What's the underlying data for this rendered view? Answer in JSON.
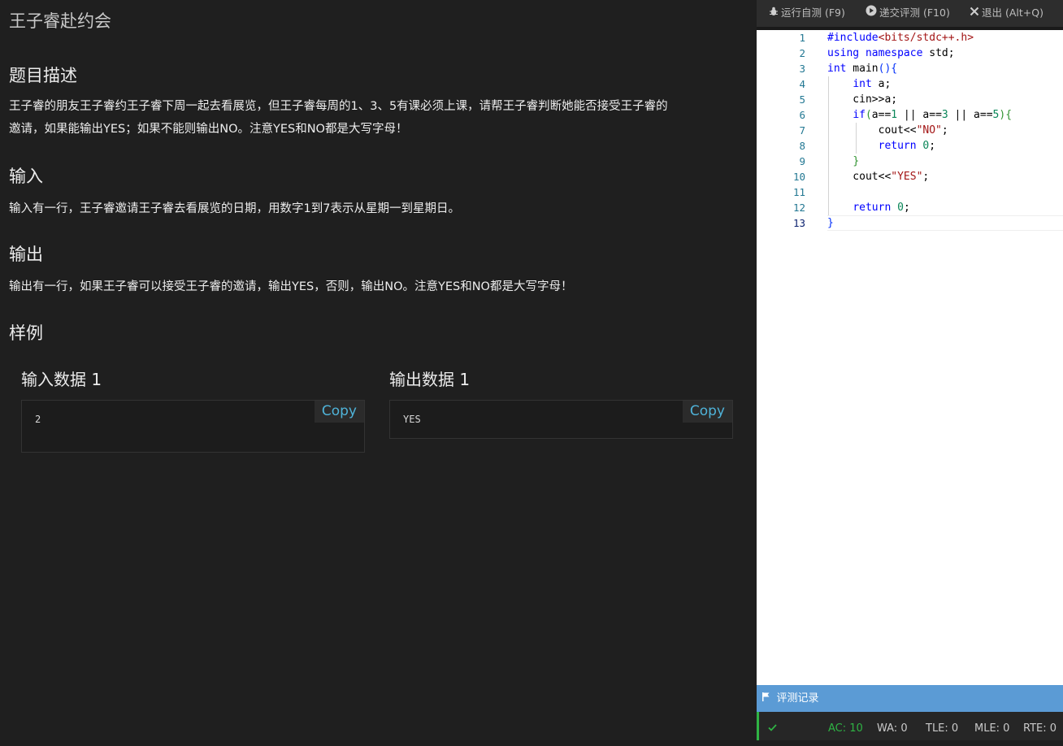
{
  "problem": {
    "title": "王子睿赴约会",
    "description_heading": "题目描述",
    "description_line1": "王子睿的朋友王子睿约王子睿下周一起去看展览，但王子睿每周的1、3、5有课必须上课，请帮王子睿判断她能否接受王子睿的",
    "description_line2": "邀请，如果能输出YES；如果不能则输出NO。注意YES和NO都是大写字母！",
    "input_heading": "输入",
    "input_text": "输入有一行，王子睿邀请王子睿去看展览的日期，用数字1到7表示从星期一到星期日。",
    "output_heading": "输出",
    "output_text": "输出有一行，如果王子睿可以接受王子睿的邀请，输出YES，否则，输出NO。注意YES和NO都是大写字母！",
    "samples_heading": "样例",
    "sample_input_title": "输入数据 1",
    "sample_input_value": "2",
    "sample_output_title": "输出数据 1",
    "sample_output_value": "YES",
    "copy_label": "Copy"
  },
  "toolbar": {
    "run_label": "运行自测 (F9)",
    "submit_label": "递交评测 (F10)",
    "exit_label": "退出 (Alt+Q)"
  },
  "editor": {
    "line_numbers": [
      "1",
      "2",
      "3",
      "4",
      "5",
      "6",
      "7",
      "8",
      "9",
      "10",
      "11",
      "12",
      "13"
    ],
    "lines": [
      "#include<bits/stdc++.h>",
      "using namespace std;",
      "int main(){",
      "    int a;",
      "    cin>>a;",
      "    if(a==1 || a==3 || a==5){",
      "        cout<<\"NO\";",
      "        return 0;",
      "    }",
      "    cout<<\"YES\";",
      "",
      "    return 0;",
      "}"
    ]
  },
  "status": {
    "heading": "评测记录",
    "ac": "AC: 10",
    "wa": "WA: 0",
    "tle": "TLE: 0",
    "mle": "MLE: 0",
    "rte": "RTE: 0",
    "colors": {
      "accent": "#5b9bd5",
      "ac": "#2fb344"
    }
  }
}
